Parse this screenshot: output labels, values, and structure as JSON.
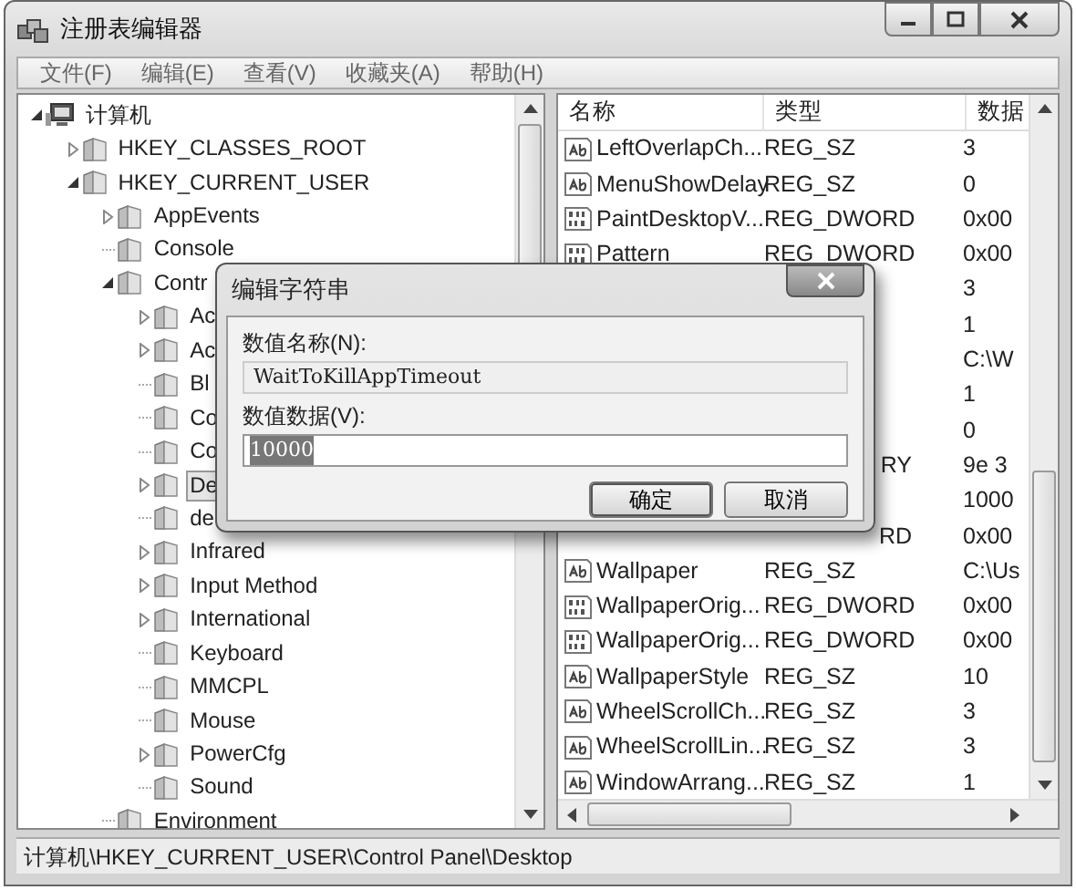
{
  "window": {
    "title": "注册表编辑器"
  },
  "menu": [
    "文件(F)",
    "编辑(E)",
    "查看(V)",
    "收藏夹(A)",
    "帮助(H)"
  ],
  "tree": [
    {
      "label": "计算机",
      "kind": "computer",
      "expanded": true,
      "selected": false,
      "children": [
        {
          "label": "HKEY_CLASSES_ROOT",
          "kind": "folder",
          "expanded": false,
          "selected": false
        },
        {
          "label": "HKEY_CURRENT_USER",
          "kind": "folder",
          "expanded": true,
          "selected": false,
          "children": [
            {
              "label": "AppEvents",
              "kind": "folder",
              "expanded": false,
              "selected": false
            },
            {
              "label": "Console",
              "kind": "folder",
              "selected": false
            },
            {
              "label": "Contr",
              "kind": "folder",
              "expanded": true,
              "selected": false,
              "children": [
                {
                  "label": "Ac",
                  "kind": "folder",
                  "expanded": false,
                  "selected": false
                },
                {
                  "label": "Ac",
                  "kind": "folder",
                  "expanded": false,
                  "selected": false
                },
                {
                  "label": "Bl",
                  "kind": "folder",
                  "selected": false
                },
                {
                  "label": "Co",
                  "kind": "folder",
                  "selected": false
                },
                {
                  "label": "Co",
                  "kind": "folder",
                  "selected": false
                },
                {
                  "label": "De",
                  "kind": "folder",
                  "expanded": false,
                  "selected": true
                },
                {
                  "label": "de",
                  "kind": "folder",
                  "selected": false
                },
                {
                  "label": "Infrared",
                  "kind": "folder",
                  "expanded": false,
                  "selected": false
                },
                {
                  "label": "Input Method",
                  "kind": "folder",
                  "expanded": false,
                  "selected": false
                },
                {
                  "label": "International",
                  "kind": "folder",
                  "expanded": false,
                  "selected": false
                },
                {
                  "label": "Keyboard",
                  "kind": "folder",
                  "selected": false
                },
                {
                  "label": "MMCPL",
                  "kind": "folder",
                  "selected": false
                },
                {
                  "label": "Mouse",
                  "kind": "folder",
                  "selected": false
                },
                {
                  "label": "PowerCfg",
                  "kind": "folder",
                  "expanded": false,
                  "selected": false
                },
                {
                  "label": "Sound",
                  "kind": "folder",
                  "selected": false
                }
              ]
            },
            {
              "label": "Environment",
              "kind": "folder",
              "selected": false
            }
          ]
        }
      ]
    }
  ],
  "list": {
    "columns": [
      "名称",
      "类型",
      "数据"
    ],
    "rows": [
      {
        "kind": "string",
        "name": "LeftOverlapCh...",
        "type": "REG_SZ",
        "data": "3"
      },
      {
        "kind": "string",
        "name": "MenuShowDelay",
        "type": "REG_SZ",
        "data": "0"
      },
      {
        "kind": "dword",
        "name": "PaintDesktopV...",
        "type": "REG_DWORD",
        "data": "0x00"
      },
      {
        "kind": "dword",
        "name": "Pattern",
        "type": "REG_DWORD",
        "data": "0x00"
      },
      {
        "kind": "covered",
        "data": "3"
      },
      {
        "kind": "covered",
        "data": "1"
      },
      {
        "kind": "covered",
        "data": "C:\\W"
      },
      {
        "kind": "covered",
        "data": "1"
      },
      {
        "kind": "covered",
        "data": "0"
      },
      {
        "kind": "covered",
        "type": "RY",
        "data": "9e 3"
      },
      {
        "kind": "covered",
        "data": "1000"
      },
      {
        "kind": "covered",
        "type": "RD",
        "data": "0x00"
      },
      {
        "kind": "string",
        "name": "Wallpaper",
        "type": "REG_SZ",
        "data": "C:\\Us"
      },
      {
        "kind": "dword",
        "name": "WallpaperOrig...",
        "type": "REG_DWORD",
        "data": "0x00"
      },
      {
        "kind": "dword",
        "name": "WallpaperOrig...",
        "type": "REG_DWORD",
        "data": "0x00"
      },
      {
        "kind": "string",
        "name": "WallpaperStyle",
        "type": "REG_SZ",
        "data": "10"
      },
      {
        "kind": "string",
        "name": "WheelScrollCh...",
        "type": "REG_SZ",
        "data": "3"
      },
      {
        "kind": "string",
        "name": "WheelScrollLin...",
        "type": "REG_SZ",
        "data": "3"
      },
      {
        "kind": "string",
        "name": "WindowArrang...",
        "type": "REG_SZ",
        "data": "1"
      }
    ]
  },
  "dialog": {
    "title": "编辑字符串",
    "name_label": "数值名称(N):",
    "name_value": "WaitToKillAppTimeout",
    "data_label": "数值数据(V):",
    "data_value": "10000",
    "data_value_selected": true,
    "buttons": [
      {
        "label": "确定",
        "default": true
      },
      {
        "label": "取消",
        "default": false
      }
    ]
  },
  "status_bar": "计算机\\HKEY_CURRENT_USER\\Control Panel\\Desktop"
}
